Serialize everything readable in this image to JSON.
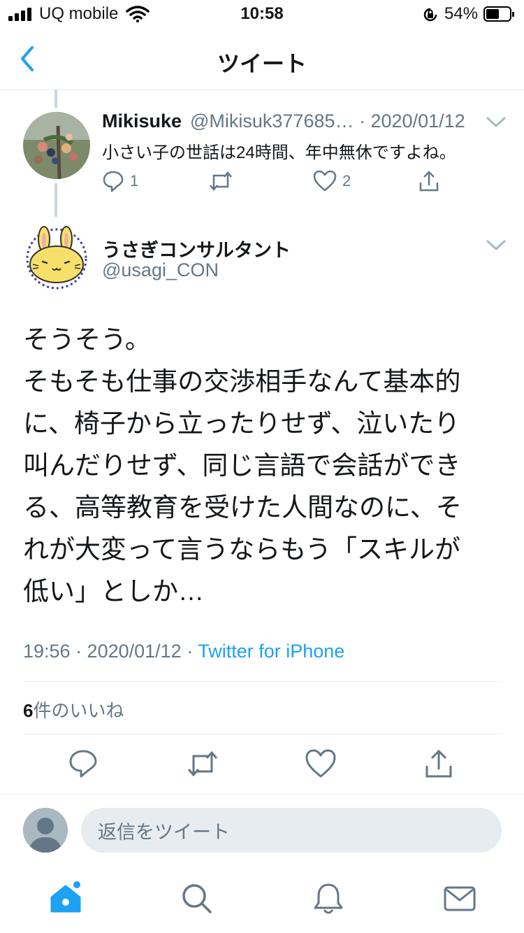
{
  "status_bar": {
    "carrier": "UQ mobile",
    "time": "10:58",
    "battery": "54%"
  },
  "nav": {
    "title": "ツイート"
  },
  "reply_tweet": {
    "name": "Mikisuke",
    "handle_date": "@Mikisuk377685… · 2020/01/12",
    "text": "小さい子の世話は24時間、年中無休ですよね。",
    "reply_count": "1",
    "like_count": "2"
  },
  "main_tweet": {
    "name": "うさぎコンサルタント",
    "handle": "@usagi_CON",
    "text_lines": [
      "そうそう。",
      "そもそも仕事の交渉相手なんて基本的",
      "に、椅子から立ったりせず、泣いたり",
      "叫んだりせず、同じ言語で会話ができ",
      "る、高等教育を受けた人間なのに、そ",
      "れが大変って言うならもう「スキルが",
      "低い」としか…"
    ],
    "time_date": "19:56 · 2020/01/12 · ",
    "source": "Twitter for iPhone",
    "like_num": "6",
    "like_label": "件のいいね"
  },
  "reply_box": {
    "placeholder": "返信をツイート"
  },
  "colors": {
    "accent": "#1da1f2",
    "text": "#14171a",
    "secondary": "#657786",
    "divider": "#e6ecf0"
  }
}
